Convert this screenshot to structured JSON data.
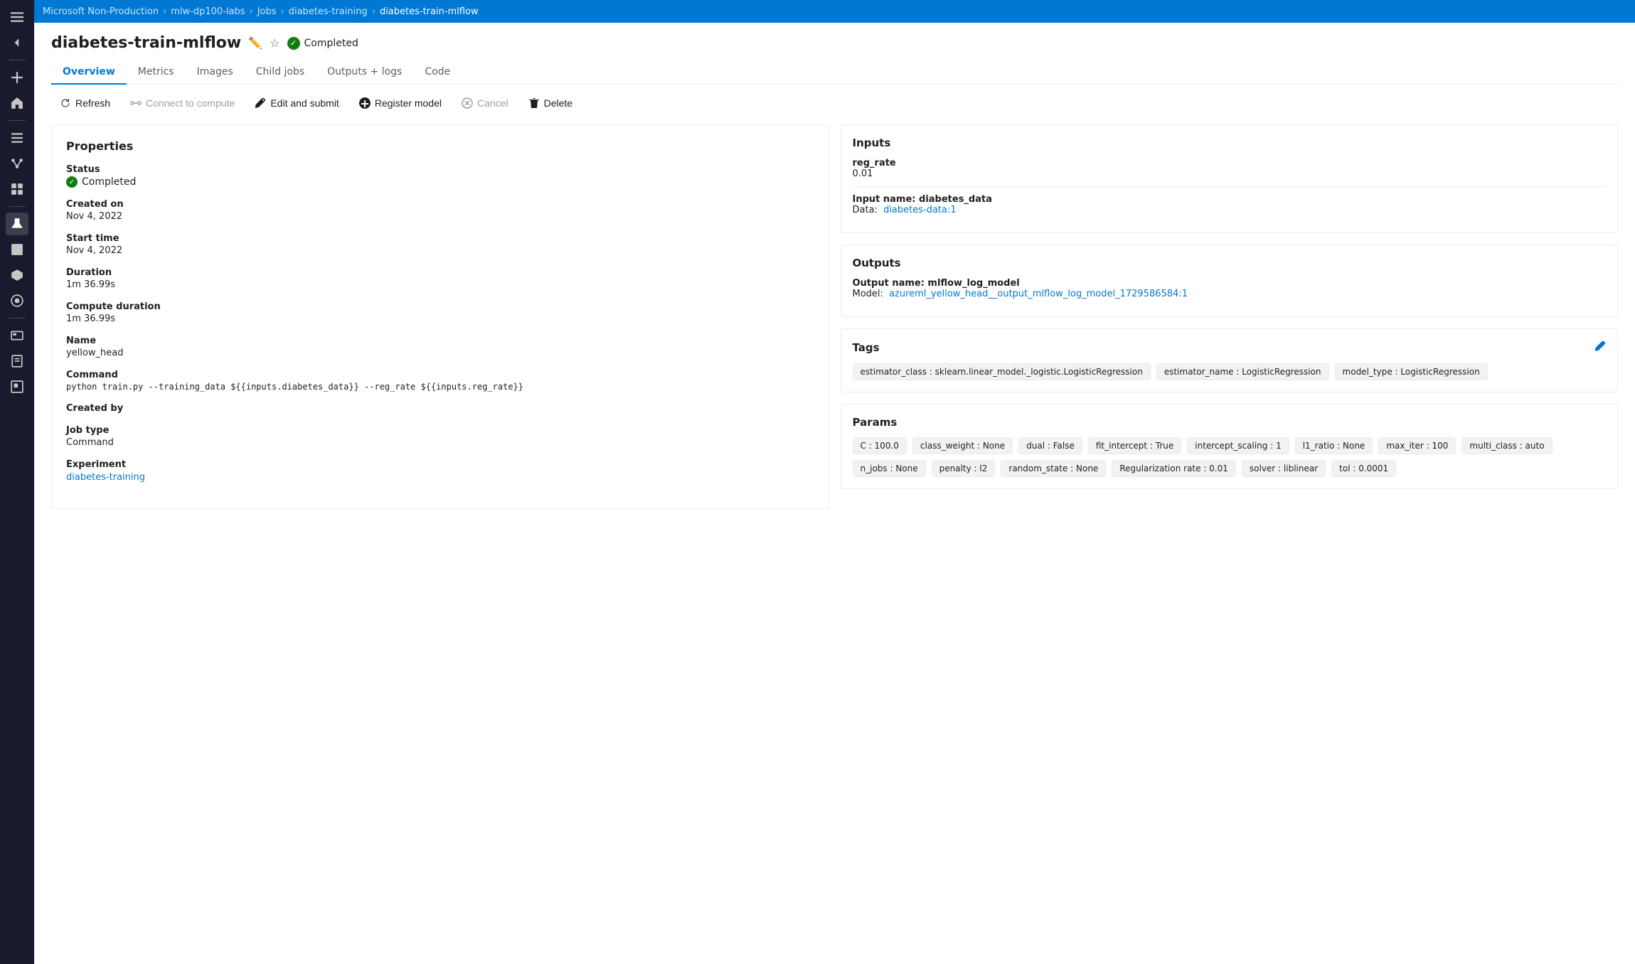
{
  "breadcrumb": {
    "items": [
      {
        "label": "Microsoft Non-Production",
        "link": true
      },
      {
        "label": "mlw-dp100-labs",
        "link": true
      },
      {
        "label": "Jobs",
        "link": true
      },
      {
        "label": "diabetes-training",
        "link": true
      },
      {
        "label": "diabetes-train-mlflow",
        "link": false
      }
    ]
  },
  "page": {
    "title": "diabetes-train-mlflow",
    "status": "Completed"
  },
  "tabs": [
    {
      "label": "Overview",
      "active": true
    },
    {
      "label": "Metrics",
      "active": false
    },
    {
      "label": "Images",
      "active": false
    },
    {
      "label": "Child jobs",
      "active": false
    },
    {
      "label": "Outputs + logs",
      "active": false
    },
    {
      "label": "Code",
      "active": false
    }
  ],
  "toolbar": {
    "refresh": "Refresh",
    "connect": "Connect to compute",
    "edit": "Edit and submit",
    "register": "Register model",
    "cancel": "Cancel",
    "delete": "Delete"
  },
  "properties": {
    "title": "Properties",
    "status_label": "Status",
    "status_value": "Completed",
    "created_on_label": "Created on",
    "created_on_value": "Nov 4, 2022",
    "start_time_label": "Start time",
    "start_time_value": "Nov 4, 2022",
    "duration_label": "Duration",
    "duration_value": "1m 36.99s",
    "compute_duration_label": "Compute duration",
    "compute_duration_value": "1m 36.99s",
    "name_label": "Name",
    "name_value": "yellow_head",
    "command_label": "Command",
    "command_value": "python train.py --training_data ${{inputs.diabetes_data}} --reg_rate ${{inputs.reg_rate}}",
    "created_by_label": "Created by",
    "created_by_value": "",
    "job_type_label": "Job type",
    "job_type_value": "Command",
    "experiment_label": "Experiment",
    "experiment_value": "diabetes-training"
  },
  "inputs": {
    "title": "Inputs",
    "reg_rate_label": "reg_rate",
    "reg_rate_value": "0.01",
    "input_name_label": "Input name: diabetes_data",
    "data_label": "Data:",
    "data_link": "diabetes-data:1"
  },
  "outputs": {
    "title": "Outputs",
    "output_name_label": "Output name: mlflow_log_model",
    "model_label": "Model:",
    "model_link_1": "azureml_yellow_head_",
    "model_link_2": "_output_mlflow_log_model_1729586584:1"
  },
  "tags": {
    "title": "Tags",
    "items": [
      "estimator_class : sklearn.linear_model._logistic.LogisticRegression",
      "estimator_name : LogisticRegression",
      "model_type : LogisticRegression"
    ]
  },
  "params": {
    "title": "Params",
    "items": [
      "C : 100.0",
      "class_weight : None",
      "dual : False",
      "fit_intercept : True",
      "intercept_scaling : 1",
      "l1_ratio : None",
      "max_iter : 100",
      "multi_class : auto",
      "n_jobs : None",
      "penalty : l2",
      "random_state : None",
      "Regularization rate : 0.01",
      "solver : liblinear",
      "tol : 0.0001"
    ]
  },
  "sidebar": {
    "icons": [
      {
        "name": "menu",
        "symbol": "☰"
      },
      {
        "name": "back",
        "symbol": "←"
      },
      {
        "name": "add",
        "symbol": "+"
      },
      {
        "name": "home",
        "symbol": "⌂"
      },
      {
        "name": "jobs",
        "symbol": "≡"
      },
      {
        "name": "pipelines",
        "symbol": "⟩"
      },
      {
        "name": "clusters",
        "symbol": "⊞"
      },
      {
        "name": "compute",
        "symbol": "▣"
      },
      {
        "name": "experiments",
        "symbol": "⚗"
      },
      {
        "name": "datasets",
        "symbol": "▦"
      },
      {
        "name": "models",
        "symbol": "◉"
      },
      {
        "name": "endpoints",
        "symbol": "⊙"
      },
      {
        "name": "monitor",
        "symbol": "⊡"
      },
      {
        "name": "notebook",
        "symbol": "✎"
      },
      {
        "name": "external",
        "symbol": "↗"
      }
    ]
  }
}
